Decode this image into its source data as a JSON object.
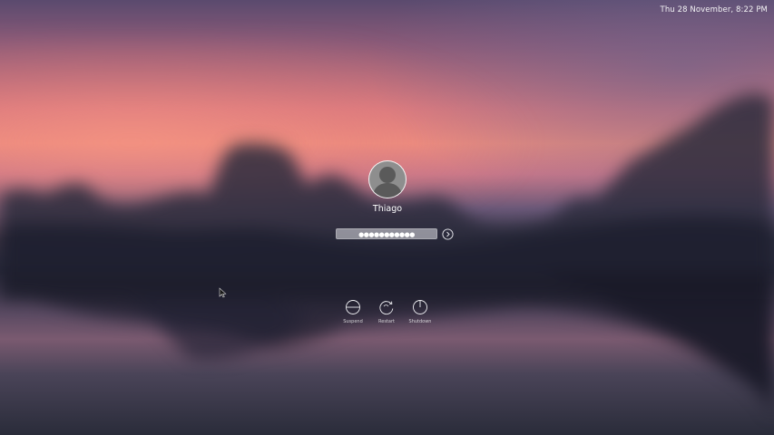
{
  "topbar": {
    "clock": "Thu 28 November, 8:22 PM"
  },
  "user": {
    "name": "Thiago",
    "avatar_icon": "user-avatar-icon"
  },
  "login": {
    "password_value": "●●●●●●●●●●●",
    "submit_icon": "arrow-right-circle-icon"
  },
  "actions": [
    {
      "label": "Suspend",
      "icon": "suspend-icon"
    },
    {
      "label": "Restart",
      "icon": "restart-icon"
    },
    {
      "label": "Shutdown",
      "icon": "power-icon"
    }
  ],
  "colors": {
    "sky_pink": "#ea8c80",
    "sky_purple": "#5a4a6e",
    "water_dark": "#2a2c3a",
    "text": "#ffffff"
  }
}
